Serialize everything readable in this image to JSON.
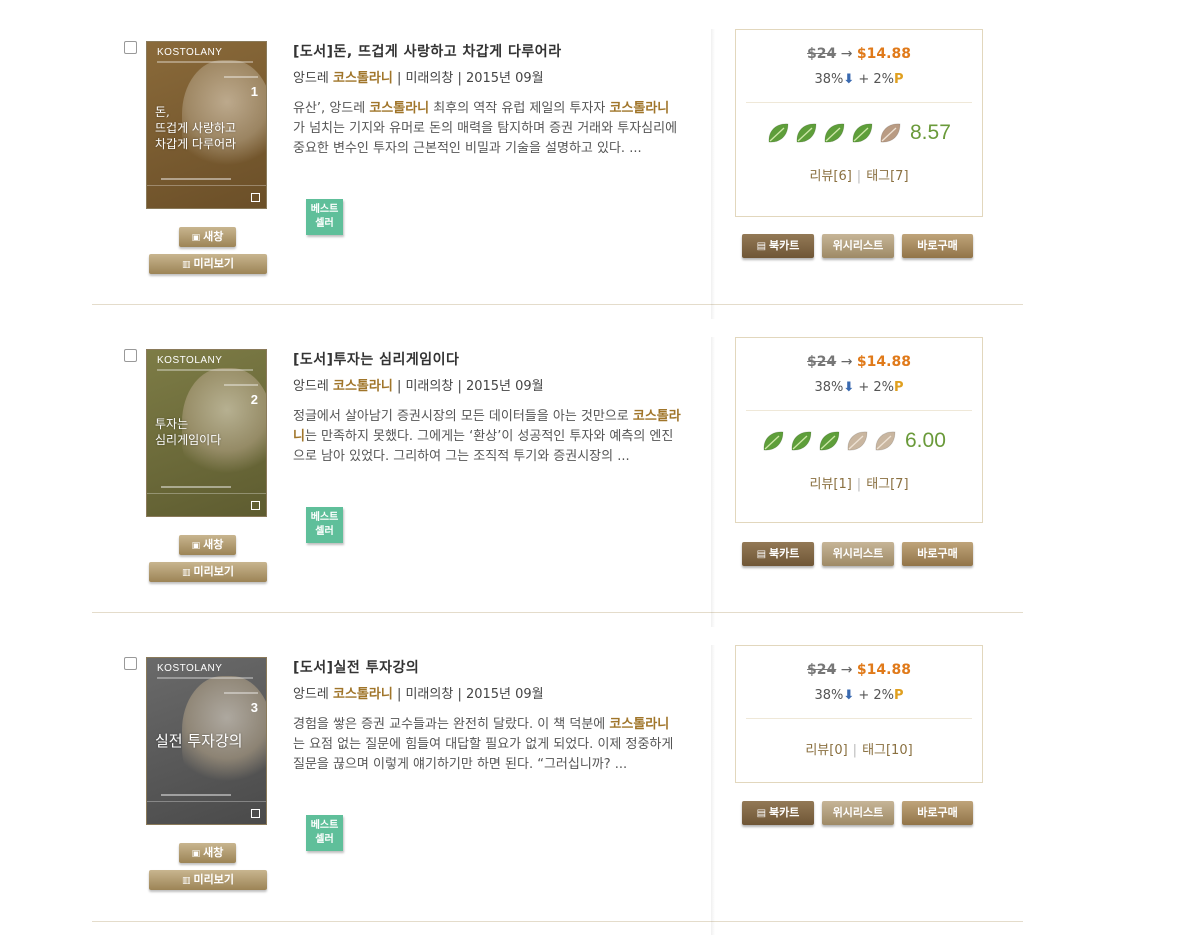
{
  "colors": {
    "accent_author": "#a0752a",
    "sale_price": "#e07a1a",
    "leaf_green": "#5e9e3a",
    "badge_green": "#5fbf9a"
  },
  "labels": {
    "new_window": "새창",
    "preview": "미리보기",
    "bestseller_line1": "베스트",
    "bestseller_line2": "셀러",
    "cart": "북카트",
    "wishlist": "위시리스트",
    "buy_now": "바로구매",
    "arrow": "→",
    "sep_bar": "|"
  },
  "books": [
    {
      "title": "[도서]돈, 뜨겁게 사랑하고 차갑게 다루어라",
      "author_prefix": "앙드레 ",
      "author_highlight": "코스톨라니",
      "publisher": " | 미래의창 | 2015년 09월",
      "desc": [
        {
          "t": "유산’, 앙드레 "
        },
        {
          "t": "코스톨라니",
          "h": true
        },
        {
          "t": " 최후의 역작 유럽 제일의 투자자 "
        },
        {
          "t": "코스톨라니",
          "h": true
        },
        {
          "t": "가 넘치는 기지와 유머로 돈의 매력을 탐지하며 증권 거래와 투자심리에 중요한 변수인 투자의 근본적인 비밀과 기술을 설명하고 있다. ..."
        }
      ],
      "cover": {
        "brand": "KOSTOLANY",
        "vol": "1",
        "title": "돈,\n뜨겁게 사랑하고\n차갑게 다루어라",
        "bg": "#8a6a3a",
        "bg2": "#6b4f28"
      },
      "price_original": "$24",
      "price_sale": "$14.88",
      "discount": "38%",
      "discount_arrow": "⬇",
      "point_text": " + 2%",
      "point_p": "P",
      "rating": 8.57,
      "rating_text": "8.57",
      "leaves": 5,
      "review": "리뷰[6]",
      "tag": "태그[7]"
    },
    {
      "title": "[도서]투자는 심리게임이다",
      "author_prefix": "앙드레 ",
      "author_highlight": "코스톨라니",
      "publisher": " | 미래의창 | 2015년 09월",
      "desc": [
        {
          "t": "정글에서 살아남기 증권시장의 모든 데이터들을 아는 것만으로 "
        },
        {
          "t": "코스톨라니",
          "h": true
        },
        {
          "t": "는 만족하지 못했다. 그에게는 ‘환상’이 성공적인 투자와 예측의 엔진으로 남아 있었다. 그리하여 그는 조직적 투기와 증권시장의 ..."
        }
      ],
      "cover": {
        "brand": "KOSTOLANY",
        "vol": "2",
        "title": "투자는\n심리게임이다",
        "bg": "#7d7c46",
        "bg2": "#5e5c30"
      },
      "price_original": "$24",
      "price_sale": "$14.88",
      "discount": "38%",
      "discount_arrow": "⬇",
      "point_text": " + 2%",
      "point_p": "P",
      "rating": 6.0,
      "rating_text": "6.00",
      "leaves": 5,
      "review": "리뷰[1]",
      "tag": "태그[7]"
    },
    {
      "title": "[도서]실전 투자강의",
      "author_prefix": "앙드레 ",
      "author_highlight": "코스톨라니",
      "publisher": " | 미래의창 | 2015년 09월",
      "desc": [
        {
          "t": "경험을 쌓은 증권 교수들과는 완전히 달랐다. 이 책 덕분에 "
        },
        {
          "t": "코스톨라니",
          "h": true
        },
        {
          "t": "는 요점 없는 질문에 힘들여 대답할 필요가 없게 되었다. 이제 정중하게 질문을 끊으며 이렇게 얘기하기만 하면 된다. “그러십니까? ..."
        }
      ],
      "cover": {
        "brand": "KOSTOLANY",
        "vol": "3",
        "title": "실전 투자강의",
        "bg": "#6a6a6a",
        "bg2": "#4a4a4a"
      },
      "price_original": "$24",
      "price_sale": "$14.88",
      "discount": "38%",
      "discount_arrow": "⬇",
      "point_text": " + 2%",
      "point_p": "P",
      "rating": null,
      "rating_text": "",
      "leaves": 0,
      "review": "리뷰[0]",
      "tag": "태그[10]"
    }
  ]
}
